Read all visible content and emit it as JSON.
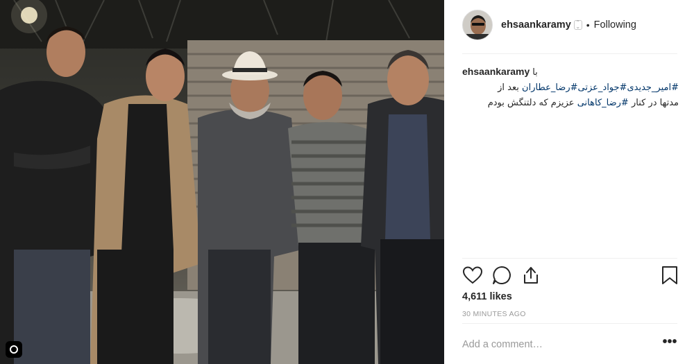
{
  "post": {
    "username": "ehsaankaramy",
    "follow_status": "Following",
    "separator": "•",
    "caption": {
      "user": "ehsaankaramy",
      "lead_word": "با",
      "line1_hashtags": "#امیر_جدیدی#جواد_عزتی#رضا_عطاران",
      "line1_tail": "بعد از",
      "line2_head": "مدتها در کنار",
      "line2_hashtag": "#رضا_کاهانی",
      "line2_tail": "عزیزم که دلتنگش بودم"
    },
    "likes": "4,611 likes",
    "timestamp": "30 MINUTES AGO",
    "comment_placeholder": "Add a comment…",
    "more_label": "•••"
  },
  "icons": {
    "like": "heart-icon",
    "comment": "comment-bubble-icon",
    "share": "share-icon",
    "save": "bookmark-icon",
    "more": "more-options-icon",
    "instagram": "instagram-glyph-icon"
  },
  "colors": {
    "text": "#262626",
    "muted": "#999999",
    "hashtag": "#003569",
    "divider": "#efefef"
  }
}
